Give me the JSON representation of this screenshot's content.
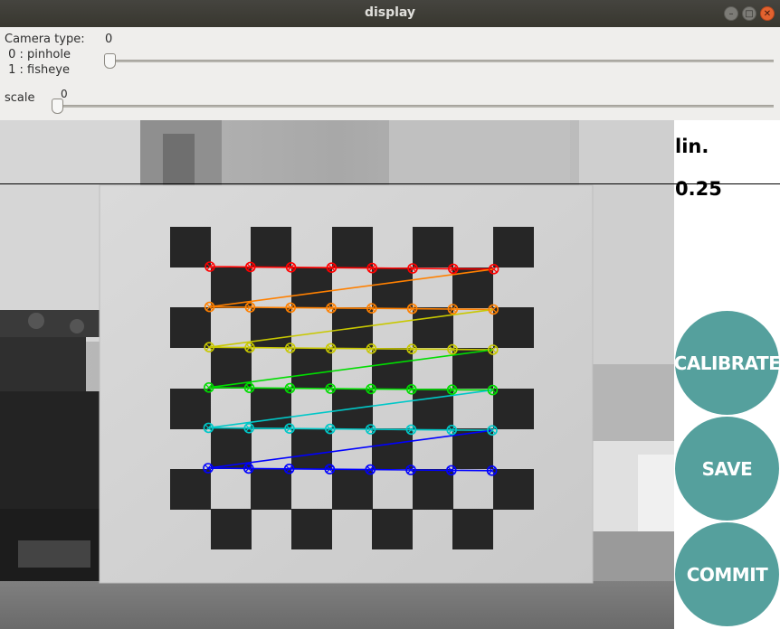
{
  "window": {
    "title": "display",
    "buttons": [
      "minimize",
      "maximize",
      "close"
    ]
  },
  "controls": {
    "camera_type": {
      "label": "Camera type:",
      "option_0": " 0 : pinhole",
      "option_1": " 1 : fisheye",
      "value": "0"
    },
    "scale": {
      "label": "scale",
      "value": "0"
    }
  },
  "overlay": {
    "text_line1": "lin.",
    "text_line2": "0.25"
  },
  "buttons": {
    "calibrate": "CALIBRATE",
    "save": "SAVE",
    "commit": "COMMIT"
  },
  "colors": {
    "button_fill": "#55a09d",
    "row_colors": [
      "#ff0000",
      "#ff8000",
      "#c8c800",
      "#00dd00",
      "#00c8c8",
      "#0000ff"
    ]
  },
  "detection": {
    "rows": 6,
    "cols": 8
  }
}
